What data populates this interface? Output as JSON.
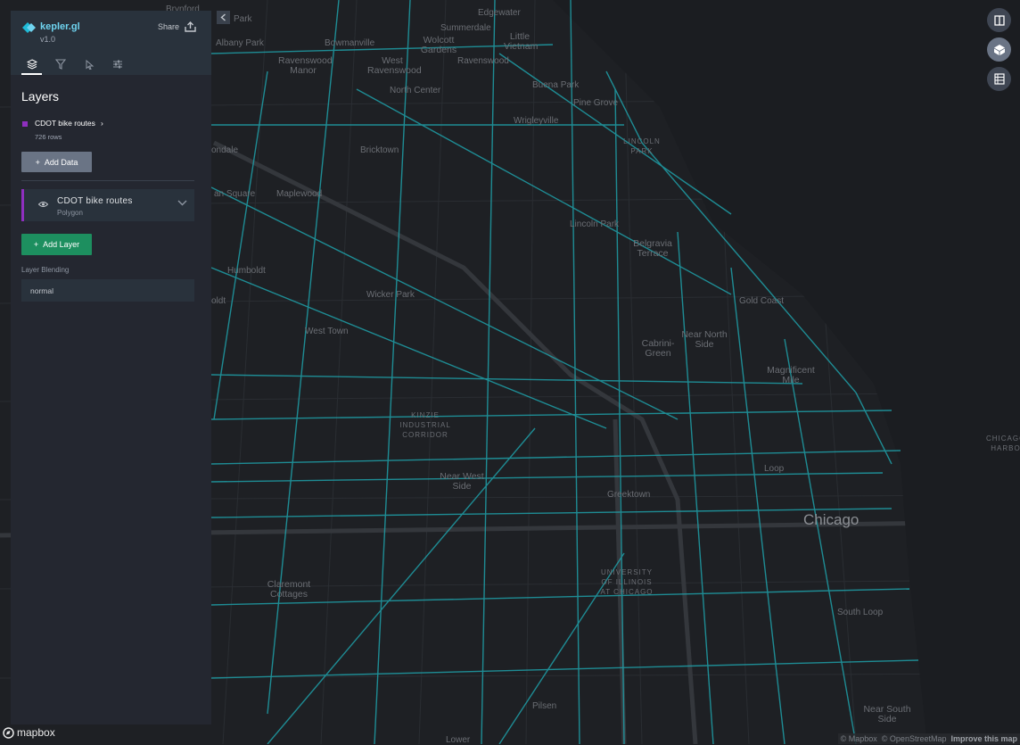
{
  "app": {
    "title": "kepler.gl",
    "version": "v1.0",
    "share_label": "Share"
  },
  "tabs": [
    {
      "name": "layers"
    },
    {
      "name": "filters"
    },
    {
      "name": "interactions"
    },
    {
      "name": "map-styles"
    }
  ],
  "layers_panel": {
    "section_title": "Layers",
    "dataset": {
      "name": "CDOT bike routes",
      "rows": "726 rows",
      "color": "#8f2fbf"
    },
    "add_data_label": "Add Data",
    "layer": {
      "name": "CDOT bike routes",
      "type": "Polygon"
    },
    "add_layer_label": "Add Layer",
    "blending_label": "Layer Blending",
    "blending_value": "normal"
  },
  "map": {
    "labels": [
      "Brynford",
      "Park",
      "Albany Park",
      "Bowmanville",
      "Wolcott Gardens",
      "Edgewater",
      "Summerdale",
      "Little Vietnam",
      "Ravenswood Manor",
      "West Ravenswood",
      "Ravenswood",
      "North Center",
      "Buena Park",
      "Pine Grove",
      "Wrigleyville",
      "LINCOLN PARK",
      "Bricktown",
      "ondale",
      "Maplewood",
      "an Square",
      "Lincoln Park",
      "Belgravia Terrace",
      "Humboldt",
      "Gold Coast",
      "Wicker Park",
      "West Town",
      "Cabrini-Green",
      "Near North Side",
      "Magnificent Mile",
      "KINZIE INDUSTRIAL CORRIDOR",
      "CHICAGO HARBO",
      "Near West Side",
      "Loop",
      "Greektown",
      "Chicago",
      "UNIVERSITY OF ILLINOIS AT CHICAGO",
      "Claremont Cottages",
      "South Loop",
      "Pilsen",
      "Near South Side",
      "Lower",
      "oldt"
    ],
    "route_color": "#1f9fa8"
  },
  "attribution": {
    "mapbox": "© Mapbox",
    "osm": "© OpenStreetMap",
    "improve": "Improve this map"
  },
  "mapbox_logo": "mapbox"
}
